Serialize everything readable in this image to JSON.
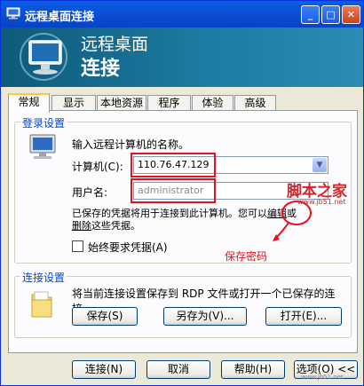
{
  "window": {
    "title": "远程桌面连接",
    "minimize_glyph": "_",
    "maximize_glyph": "□",
    "close_glyph": "✕"
  },
  "banner": {
    "line1": "远程桌面",
    "line2": "连接"
  },
  "tabs": [
    {
      "label": "常规",
      "active": true
    },
    {
      "label": "显示"
    },
    {
      "label": "本地资源"
    },
    {
      "label": "程序"
    },
    {
      "label": "体验"
    },
    {
      "label": "高级"
    }
  ],
  "login": {
    "legend": "登录设置",
    "prompt": "输入远程计算机的名称。",
    "computer_label": "计算机(C):",
    "computer_value": "110.76.47.129",
    "username_label": "用户名:",
    "username_value": "administrator",
    "saved_line1_a": "已保存的凭据将用于连接到此计算机。您可以",
    "saved_line1_link": "编辑",
    "saved_line1_b": "或",
    "saved_line2_link": "删除",
    "saved_line2_b": "这些凭据。",
    "always_ask_label": "始终要求凭据(A)",
    "always_ask_checked": false
  },
  "annotation": {
    "save_password": "保存密码"
  },
  "connection": {
    "legend": "连接设置",
    "description": "将当前连接设置保存到 RDP 文件或打开一个已保存的连接。",
    "save_button": "保存(S)",
    "save_as_button": "另存为(V)...",
    "open_button": "打开(E)..."
  },
  "footer": {
    "connect_button": "连接(N)",
    "cancel_button": "取消",
    "help_button": "帮助(H)",
    "options_button": "选项(O) <<"
  },
  "watermark": {
    "cn": "脚本之家",
    "url": "www.jb51.net"
  },
  "colors": {
    "annotation_red": "#e8101a",
    "legend_blue": "#0046d5",
    "titlebar_blue": "#0a5fe6"
  }
}
